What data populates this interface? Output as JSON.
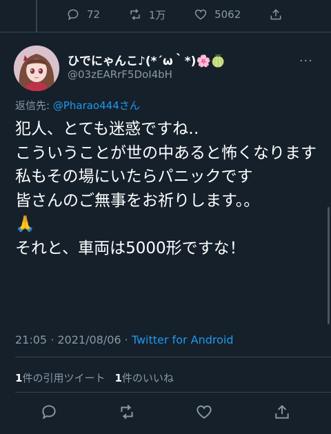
{
  "top_actions": {
    "reply_count": "72",
    "retweet_count": "1万",
    "like_count": "5062"
  },
  "tweet": {
    "display_name": "ひでにゃんこ♪(*´ω｀*)🌸🍈",
    "handle": "@03zEARrF5DoI4bH",
    "reply_prefix": "返信先: ",
    "reply_mention": "@Pharao444さん",
    "text": "犯人、とても迷惑ですね‥\nこういうことが世の中あると怖くなります\n私もその場にいたらパニックです\n皆さんのご無事をお祈りします。。\n🙏\nそれと、車両は5000形ですな！",
    "timestamp": "21:05 · 2021/08/06 · ",
    "source": "Twitter for Android"
  },
  "stats": {
    "quote_count": "1",
    "quote_label": "件の引用ツイート",
    "like_count": "1",
    "like_label": "件のいいね"
  },
  "colors": {
    "background": "#15202b",
    "secondary_text": "#8b98a5",
    "accent": "#1d9bf0",
    "divider": "#38444d"
  }
}
